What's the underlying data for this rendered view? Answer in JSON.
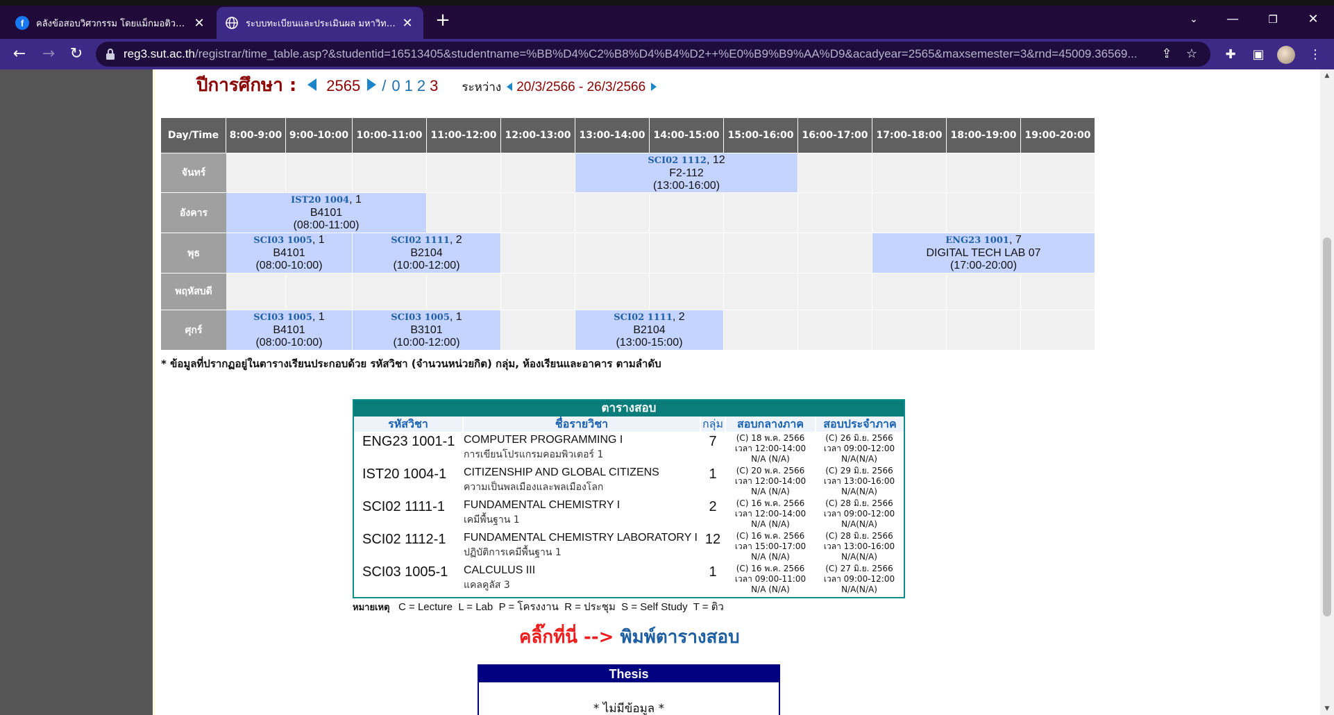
{
  "browser": {
    "tabs": [
      {
        "title": "คลังข้อสอบวิศวกรรม โดยแม็กมอติวเตอ"
      },
      {
        "title": "ระบบทะเบียนและประเมินผล มหาวิทยาลั"
      }
    ],
    "url_host": "reg3.sut.ac.th",
    "url_rest": "/registrar/time_table.asp?&studentid=16513405&studentname=%BB%D4%C2%B8%D4%B4%D2++%E0%B9%B9%AA%D9&acadyear=2565&maxsemester=3&rnd=45009.36569..."
  },
  "header": {
    "label": "ปีการศึกษา :",
    "year": "2565",
    "separator": "/",
    "semesters": [
      "0",
      "1",
      "2"
    ],
    "current_semester": "3",
    "range_label": "ระหว่าง",
    "range": "20/3/2566 - 26/3/2566"
  },
  "timetable": {
    "header": [
      "Day/Time",
      "8:00-9:00",
      "9:00-10:00",
      "10:00-11:00",
      "11:00-12:00",
      "12:00-13:00",
      "13:00-14:00",
      "14:00-15:00",
      "15:00-16:00",
      "16:00-17:00",
      "17:00-18:00",
      "18:00-19:00",
      "19:00-20:00"
    ],
    "days": [
      "จันทร์",
      "อังคาร",
      "พุธ",
      "พฤหัสบดี",
      "ศุกร์"
    ],
    "classes": [
      {
        "code": "SCI02 1112",
        "group": ", 12",
        "room": "F2-112",
        "time": "(13:00-16:00)"
      },
      {
        "code": "IST20 1004",
        "group": ", 1",
        "room": "B4101",
        "time": "(08:00-11:00)"
      },
      {
        "code": "SCI03 1005",
        "group": ", 1",
        "room": "B4101",
        "time": "(08:00-10:00)"
      },
      {
        "code": "SCI02 1111",
        "group": ", 2",
        "room": "B2104",
        "time": "(10:00-12:00)"
      },
      {
        "code": "ENG23 1001",
        "group": ", 7",
        "room": "DIGITAL TECH LAB 07",
        "time": "(17:00-20:00)"
      },
      {
        "code": "SCI03 1005",
        "group": ", 1",
        "room": "B4101",
        "time": "(08:00-10:00)"
      },
      {
        "code": "SCI03 1005",
        "group": ", 1",
        "room": "B3101",
        "time": "(10:00-12:00)"
      },
      {
        "code": "SCI02 1111",
        "group": ", 2",
        "room": "B2104",
        "time": "(13:00-15:00)"
      }
    ],
    "note": "* ข้อมูลที่ปรากฏอยู่ในตารางเรียนประกอบด้วย รหัสวิชา (จำนวนหน่วยกิต) กลุ่ม, ห้องเรียนและอาคาร ตามลำดับ"
  },
  "exam": {
    "title": "ตารางสอบ",
    "columns": [
      "รหัสวิชา",
      "ชื่อรายวิชา",
      "กลุ่ม",
      "สอบกลางภาค",
      "สอบประจำภาค"
    ],
    "rows": [
      {
        "code": "ENG23 1001-1",
        "name": "COMPUTER PROGRAMMING I",
        "name_th": "การเขียนโปรแกรมคอมพิวเตอร์ 1",
        "group": "7",
        "mid": [
          "(C) 18 พ.ค. 2566",
          "เวลา 12:00-14:00",
          "N/A (N/A)"
        ],
        "final": [
          "(C) 26 มิ.ย. 2566",
          "เวลา 09:00-12:00",
          "N/A(N/A)"
        ]
      },
      {
        "code": "IST20 1004-1",
        "name": "CITIZENSHIP AND GLOBAL CITIZENS",
        "name_th": "ความเป็นพลเมืองและพลเมืองโลก",
        "group": "1",
        "mid": [
          "(C) 20 พ.ค. 2566",
          "เวลา 12:00-14:00",
          "N/A (N/A)"
        ],
        "final": [
          "(C) 29 มิ.ย. 2566",
          "เวลา 13:00-16:00",
          "N/A(N/A)"
        ]
      },
      {
        "code": "SCI02 1111-1",
        "name": "FUNDAMENTAL CHEMISTRY I",
        "name_th": "เคมีพื้นฐาน 1",
        "group": "2",
        "mid": [
          "(C) 16 พ.ค. 2566",
          "เวลา 12:00-14:00",
          "N/A (N/A)"
        ],
        "final": [
          "(C) 28 มิ.ย. 2566",
          "เวลา 09:00-12:00",
          "N/A(N/A)"
        ]
      },
      {
        "code": "SCI02 1112-1",
        "name": "FUNDAMENTAL CHEMISTRY LABORATORY I",
        "name_th": "ปฏิบัติการเคมีพื้นฐาน 1",
        "group": "12",
        "mid": [
          "(C) 16 พ.ค. 2566",
          "เวลา 15:00-17:00",
          "N/A (N/A)"
        ],
        "final": [
          "(C) 28 มิ.ย. 2566",
          "เวลา 13:00-16:00",
          "N/A(N/A)"
        ]
      },
      {
        "code": "SCI03 1005-1",
        "name": "CALCULUS III",
        "name_th": "แคลคูลัส 3",
        "group": "1",
        "mid": [
          "(C) 16 พ.ค. 2566",
          "เวลา 09:00-11:00",
          "N/A (N/A)"
        ],
        "final": [
          "(C) 27 มิ.ย. 2566",
          "เวลา 09:00-12:00",
          "N/A(N/A)"
        ]
      }
    ],
    "legend_label": "หมายเหตุ",
    "legend_text": "C = Lecture  L = Lab  P = โครงงาน  R = ประชุม  S = Self Study  T = ติว"
  },
  "print": {
    "click_text": "คลิ๊กที่นี่ -->",
    "link_text": "พิมพ์ตารางสอบ"
  },
  "thesis": {
    "title": "Thesis",
    "body": "* ไม่มีข้อมูล *"
  }
}
